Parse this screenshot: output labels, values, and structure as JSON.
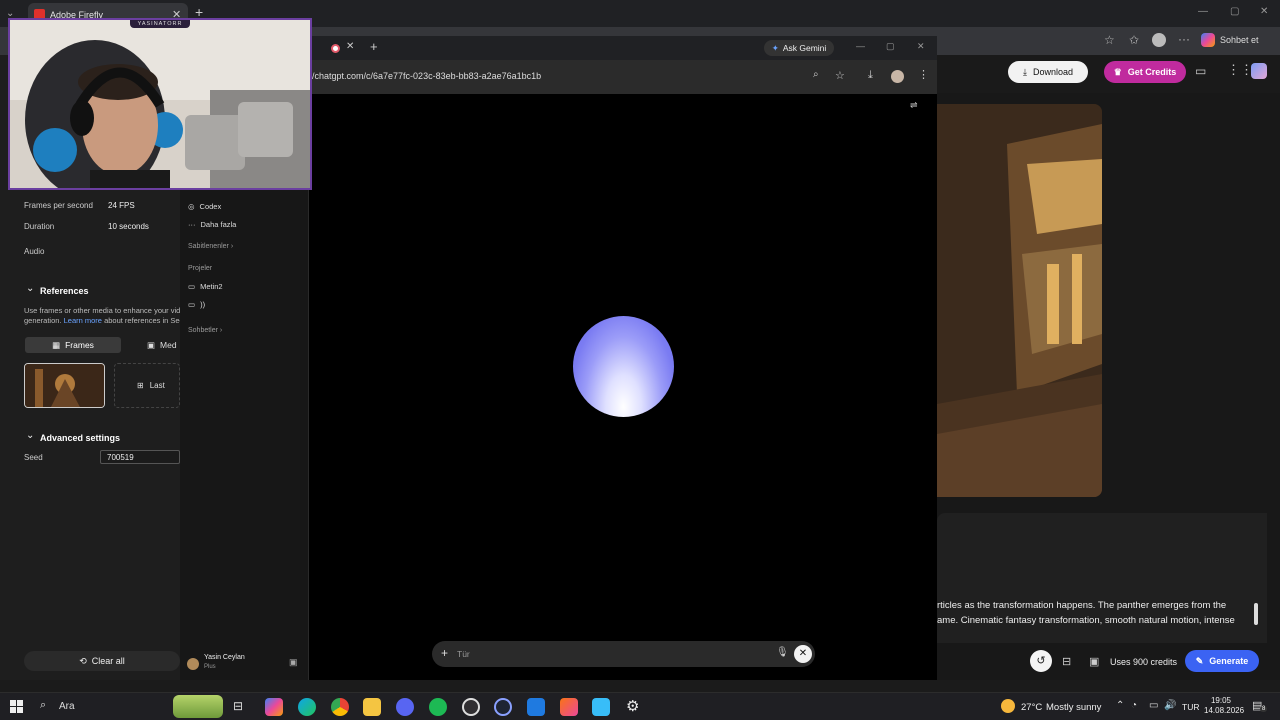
{
  "back_browser": {
    "tab_title": "Adobe Firefly",
    "toolbar_right_label": "Sohbet et"
  },
  "firefly": {
    "download_label": "Download",
    "get_credits_label": "Get Credits",
    "prompt_line1": "rticles as the transformation happens. The panther emerges from the",
    "prompt_line2": "ame. Cinematic fantasy transformation, smooth natural motion, intense",
    "credits_label": "Uses 900 credits",
    "generate_label": "Generate",
    "settings": {
      "fps_label": "Frames per second",
      "fps_value": "24 FPS",
      "duration_label": "Duration",
      "duration_value": "10 seconds",
      "audio_label": "Audio"
    },
    "references": {
      "title": "References",
      "description_line1": "Use frames or other media to enhance your vide",
      "description_line2_prefix": "generation.",
      "learn_more": "Learn more",
      "description_line2_suffix": "about references in Seec",
      "frames_tab": "Frames",
      "media_tab": "Med",
      "last_label": "Last"
    },
    "advanced": {
      "title": "Advanced settings",
      "seed_label": "Seed",
      "seed_value": "700519"
    },
    "clear_all": "Clear all"
  },
  "chat_browser": {
    "ask_gemini": "Ask Gemini",
    "url": "/chatgpt.com/c/6a7e77fc-023c-83eb-bb83-a2ae76a1bc1b",
    "sidebar": {
      "codex": "Codex",
      "more": "Daha fazla",
      "pinned": "Sabitlenenler",
      "projects": "Projeler",
      "project1": "Metin2",
      "project2": "))",
      "chats": "Sohbetler",
      "user_name": "Yasin Ceylan",
      "user_plan": "Plus"
    },
    "composer_placeholder": "Tür"
  },
  "webcam": {
    "overlay_name": "YASINATORR"
  },
  "taskbar": {
    "search_label": "Ara",
    "temperature": "27°C",
    "weather": "Mostly sunny",
    "language": "TUR",
    "time": "19:05",
    "date": "14.08.2026",
    "notification_count": "8"
  }
}
